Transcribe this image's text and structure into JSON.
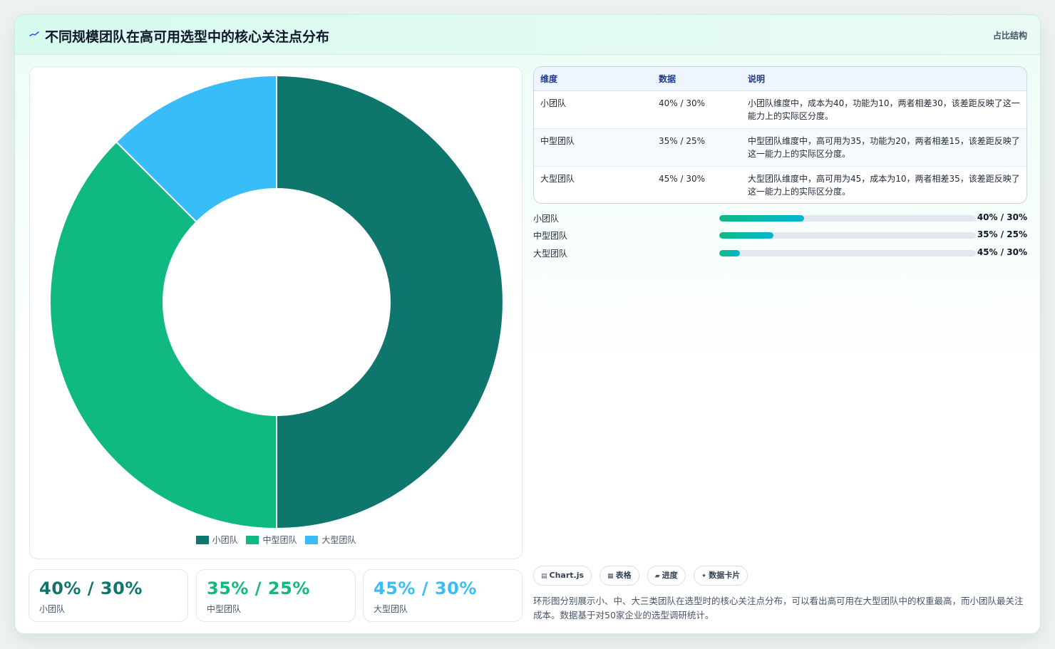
{
  "header": {
    "title": "不同规模团队在高可用选型中的核心关注点分布",
    "tag": "占比结构"
  },
  "colors": {
    "small": "#0f766e",
    "medium": "#10b981",
    "large": "#38bdf8",
    "accent": "#14b8a6"
  },
  "chart_data": {
    "type": "doughnut",
    "categories": [
      "小团队",
      "中型团队",
      "大型团队"
    ],
    "values": [
      40,
      30,
      10
    ],
    "colors": [
      "#0f766e",
      "#10b981",
      "#38bdf8"
    ],
    "legend": "bottom"
  },
  "stats": [
    {
      "value": "40% / 30%",
      "label": "小团队"
    },
    {
      "value": "35% / 25%",
      "label": "中型团队"
    },
    {
      "value": "45% / 30%",
      "label": "大型团队"
    }
  ],
  "table": {
    "headers": [
      "维度",
      "数据",
      "说明"
    ],
    "rows": [
      {
        "dim": "小团队",
        "data": "40% / 30%",
        "note": "小团队维度中，成本为40，功能为10，两者相差30，该差距反映了这一能力上的实际区分度。"
      },
      {
        "dim": "中型团队",
        "data": "35% / 25%",
        "note": "中型团队维度中，高可用为35，功能为20，两者相差15，该差距反映了这一能力上的实际区分度。"
      },
      {
        "dim": "大型团队",
        "data": "45% / 30%",
        "note": "大型团队维度中，高可用为45，成本为10，两者相差35，该差距反映了这一能力上的实际区分度。"
      }
    ]
  },
  "progress": [
    {
      "label": "小团队",
      "value": "40% / 30%",
      "fraction": 0.33
    },
    {
      "label": "中型团队",
      "value": "35% / 25%",
      "fraction": 0.21
    },
    {
      "label": "大型团队",
      "value": "45% / 30%",
      "fraction": 0.08
    }
  ],
  "chips": [
    {
      "icon": "chart-icon",
      "label": "Chart.js"
    },
    {
      "icon": "table-icon",
      "label": "表格"
    },
    {
      "icon": "progress-icon",
      "label": "进度"
    },
    {
      "icon": "sparkle-icon",
      "label": "数据卡片"
    }
  ],
  "description": "环形图分别展示小、中、大三类团队在选型时的核心关注点分布，可以看出高可用在大型团队中的权重最高，而小团队最关注成本。数据基于对50家企业的选型调研统计。"
}
